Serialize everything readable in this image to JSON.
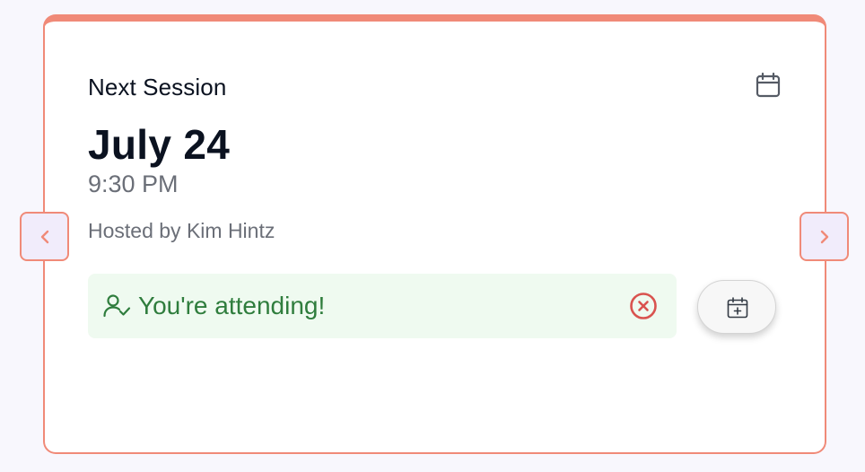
{
  "session": {
    "title": "Next Session",
    "date": "July 24",
    "time": "9:30 PM",
    "host": "Hosted by Kim Hintz"
  },
  "attendance": {
    "status_text": "You're attending!"
  },
  "icons": {
    "calendar": "calendar-icon",
    "user_check": "user-check-icon",
    "cancel": "x-circle-icon",
    "add_to_calendar": "calendar-plus-icon",
    "prev": "chevron-left-icon",
    "next": "chevron-right-icon"
  },
  "colors": {
    "accent": "#f08a78",
    "success_text": "#2f7d3d",
    "success_bg": "#effaf0",
    "cancel": "#d9534f",
    "nav_bg": "#f1ecfb"
  }
}
